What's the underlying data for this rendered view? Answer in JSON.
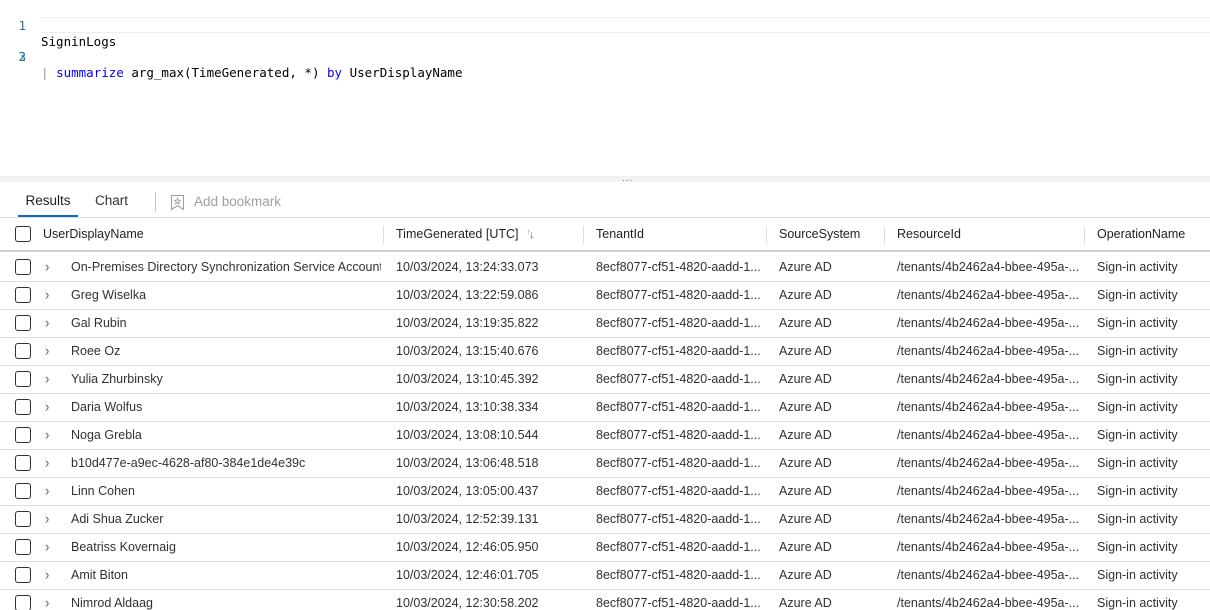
{
  "editor": {
    "lines": [
      {
        "number": "1",
        "tokens": [
          {
            "text": "SigninLogs",
            "kind": "plain"
          }
        ]
      },
      {
        "number": "2",
        "tokens": [
          {
            "text": "| ",
            "kind": "plain"
          },
          {
            "text": "summarize",
            "kind": "keyword"
          },
          {
            "text": " arg_max(TimeGenerated, *) ",
            "kind": "plain"
          },
          {
            "text": "by",
            "kind": "keyword"
          },
          {
            "text": " UserDisplayName",
            "kind": "plain"
          }
        ]
      },
      {
        "number": "3",
        "tokens": []
      }
    ],
    "line_numbers": [
      "1",
      "2",
      "3"
    ],
    "line1": "SigninLogs",
    "line2_pipe": "| ",
    "line2_kw1": "summarize",
    "line2_mid": " arg_max(TimeGenerated, *) ",
    "line2_kw2": "by",
    "line2_end": " UserDisplayName"
  },
  "splitter": {
    "handle": "..."
  },
  "tabs": {
    "results": "Results",
    "chart": "Chart",
    "active": "Results",
    "bookmark_label": "Add bookmark",
    "bookmark_icon": "bookmark-icon"
  },
  "colors": {
    "accent": "#0f6cbd",
    "keyword": "#0000ff",
    "line_number": "#237893"
  },
  "grid": {
    "columns": [
      {
        "key": "user",
        "label": "UserDisplayName"
      },
      {
        "key": "time",
        "label": "TimeGenerated [UTC]",
        "sortable": true
      },
      {
        "key": "tenant",
        "label": "TenantId"
      },
      {
        "key": "source",
        "label": "SourceSystem"
      },
      {
        "key": "resource",
        "label": "ResourceId"
      },
      {
        "key": "operation",
        "label": "OperationName"
      }
    ],
    "rows": [
      {
        "user": "On-Premises Directory Synchronization Service Account",
        "time": "10/03/2024, 13:24:33.073",
        "tenant": "8ecf8077-cf51-4820-aadd-1...",
        "source": "Azure AD",
        "resource": "/tenants/4b2462a4-bbee-495a-...",
        "operation": "Sign-in activity"
      },
      {
        "user": "Greg Wiselka",
        "time": "10/03/2024, 13:22:59.086",
        "tenant": "8ecf8077-cf51-4820-aadd-1...",
        "source": "Azure AD",
        "resource": "/tenants/4b2462a4-bbee-495a-...",
        "operation": "Sign-in activity"
      },
      {
        "user": "Gal Rubin",
        "time": "10/03/2024, 13:19:35.822",
        "tenant": "8ecf8077-cf51-4820-aadd-1...",
        "source": "Azure AD",
        "resource": "/tenants/4b2462a4-bbee-495a-...",
        "operation": "Sign-in activity"
      },
      {
        "user": "Roee Oz",
        "time": "10/03/2024, 13:15:40.676",
        "tenant": "8ecf8077-cf51-4820-aadd-1...",
        "source": "Azure AD",
        "resource": "/tenants/4b2462a4-bbee-495a-...",
        "operation": "Sign-in activity"
      },
      {
        "user": "Yulia Zhurbinsky",
        "time": "10/03/2024, 13:10:45.392",
        "tenant": "8ecf8077-cf51-4820-aadd-1...",
        "source": "Azure AD",
        "resource": "/tenants/4b2462a4-bbee-495a-...",
        "operation": "Sign-in activity"
      },
      {
        "user": "Daria Wolfus",
        "time": "10/03/2024, 13:10:38.334",
        "tenant": "8ecf8077-cf51-4820-aadd-1...",
        "source": "Azure AD",
        "resource": "/tenants/4b2462a4-bbee-495a-...",
        "operation": "Sign-in activity"
      },
      {
        "user": "Noga Grebla",
        "time": "10/03/2024, 13:08:10.544",
        "tenant": "8ecf8077-cf51-4820-aadd-1...",
        "source": "Azure AD",
        "resource": "/tenants/4b2462a4-bbee-495a-...",
        "operation": "Sign-in activity"
      },
      {
        "user": "b10d477e-a9ec-4628-af80-384e1de4e39c",
        "time": "10/03/2024, 13:06:48.518",
        "tenant": "8ecf8077-cf51-4820-aadd-1...",
        "source": "Azure AD",
        "resource": "/tenants/4b2462a4-bbee-495a-...",
        "operation": "Sign-in activity"
      },
      {
        "user": "Linn Cohen",
        "time": "10/03/2024, 13:05:00.437",
        "tenant": "8ecf8077-cf51-4820-aadd-1...",
        "source": "Azure AD",
        "resource": "/tenants/4b2462a4-bbee-495a-...",
        "operation": "Sign-in activity"
      },
      {
        "user": "Adi Shua Zucker",
        "time": "10/03/2024, 12:52:39.131",
        "tenant": "8ecf8077-cf51-4820-aadd-1...",
        "source": "Azure AD",
        "resource": "/tenants/4b2462a4-bbee-495a-...",
        "operation": "Sign-in activity"
      },
      {
        "user": "Beatriss Kovernaig",
        "time": "10/03/2024, 12:46:05.950",
        "tenant": "8ecf8077-cf51-4820-aadd-1...",
        "source": "Azure AD",
        "resource": "/tenants/4b2462a4-bbee-495a-...",
        "operation": "Sign-in activity"
      },
      {
        "user": "Amit Biton",
        "time": "10/03/2024, 12:46:01.705",
        "tenant": "8ecf8077-cf51-4820-aadd-1...",
        "source": "Azure AD",
        "resource": "/tenants/4b2462a4-bbee-495a-...",
        "operation": "Sign-in activity"
      },
      {
        "user": "Nimrod Aldaag",
        "time": "10/03/2024, 12:30:58.202",
        "tenant": "8ecf8077-cf51-4820-aadd-1...",
        "source": "Azure AD",
        "resource": "/tenants/4b2462a4-bbee-495a-...",
        "operation": "Sign-in activity"
      }
    ]
  }
}
